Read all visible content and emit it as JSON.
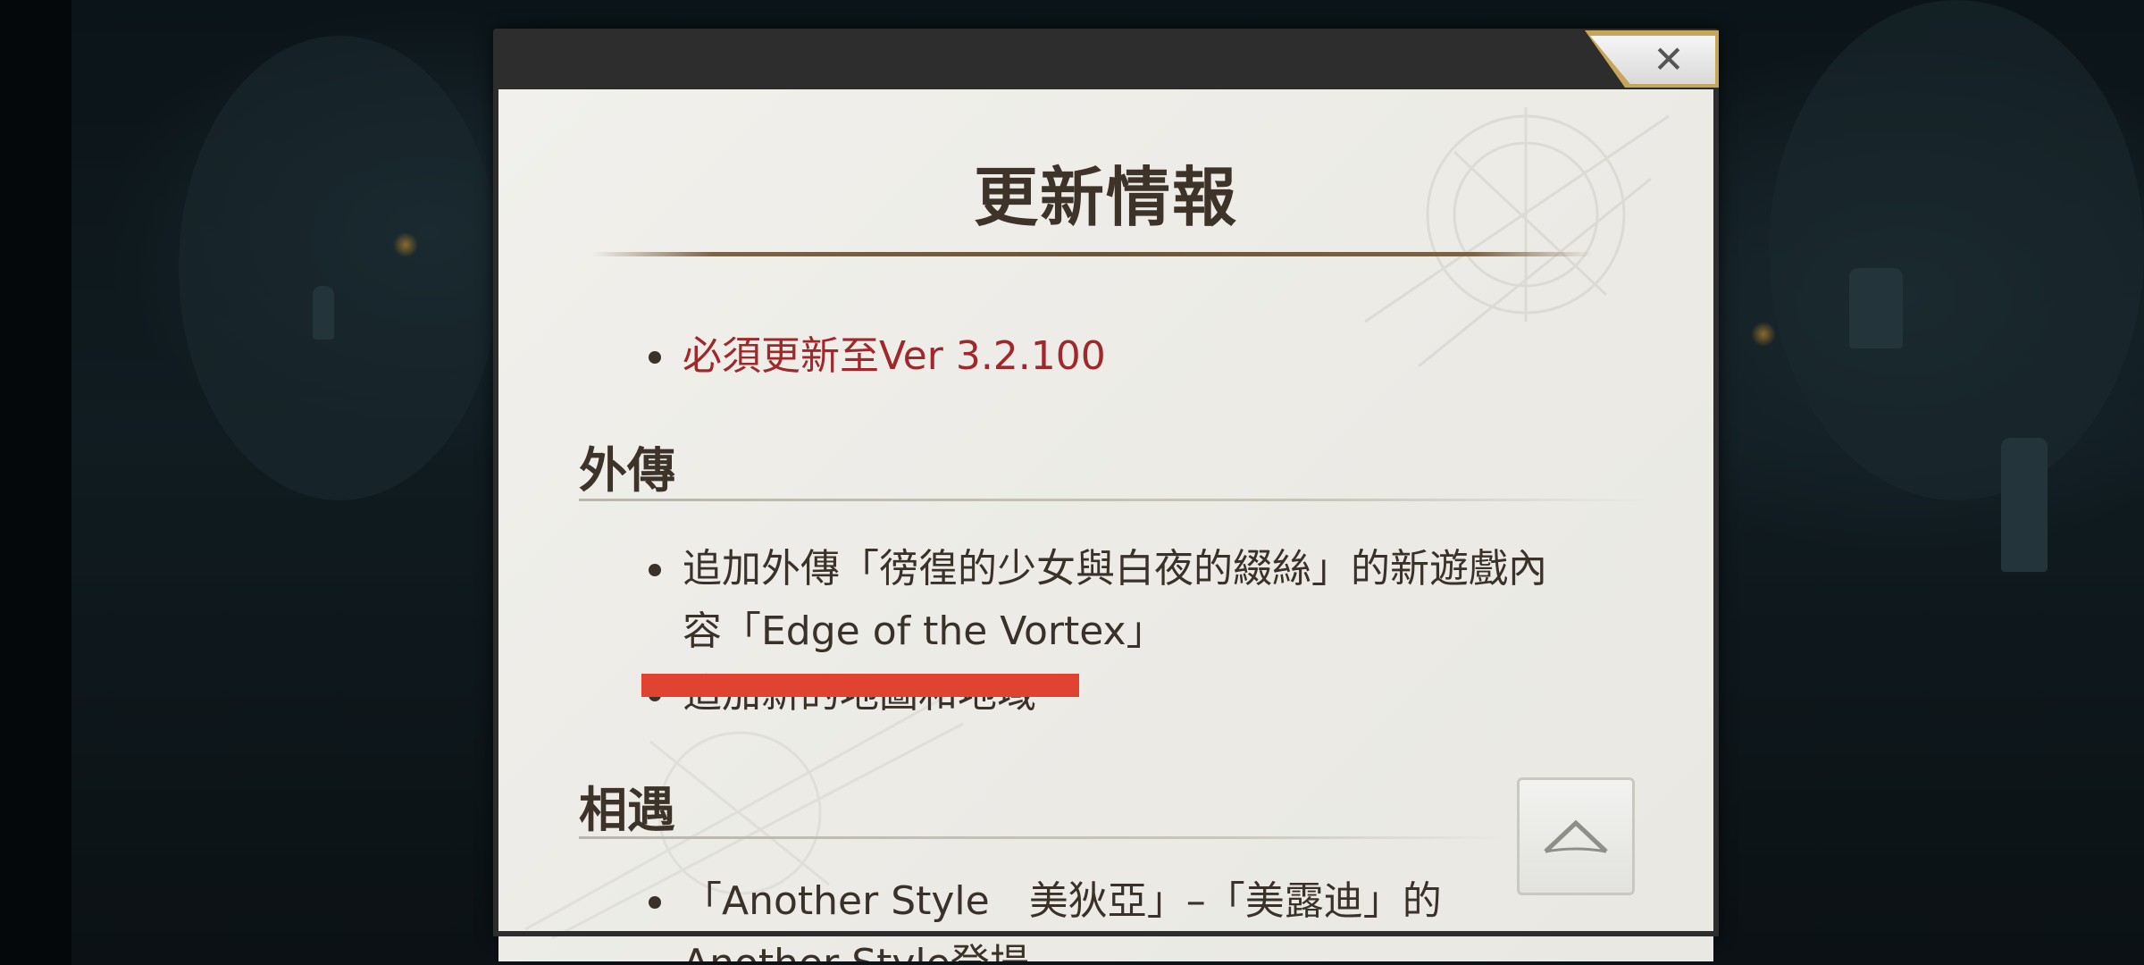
{
  "dialog": {
    "title": "更新情報",
    "close_icon": "close-icon",
    "scroll_top_icon": "chevron-up-icon",
    "accent_color": "#c7a65a",
    "notice": "必須更新至Ver 3.2.100",
    "notice_color": "#a1282a",
    "sections": [
      {
        "title": "外傳",
        "items": [
          "追加外傳「徬徨的少女與白夜的綴絲」的新遊戲內",
          "容「Edge of the Vortex」",
          "追加新的地圖和地域"
        ]
      },
      {
        "title": "相遇",
        "items": [
          "「Another Style　美狄亞」–「美露迪」的",
          "Another Style登場"
        ]
      }
    ]
  }
}
